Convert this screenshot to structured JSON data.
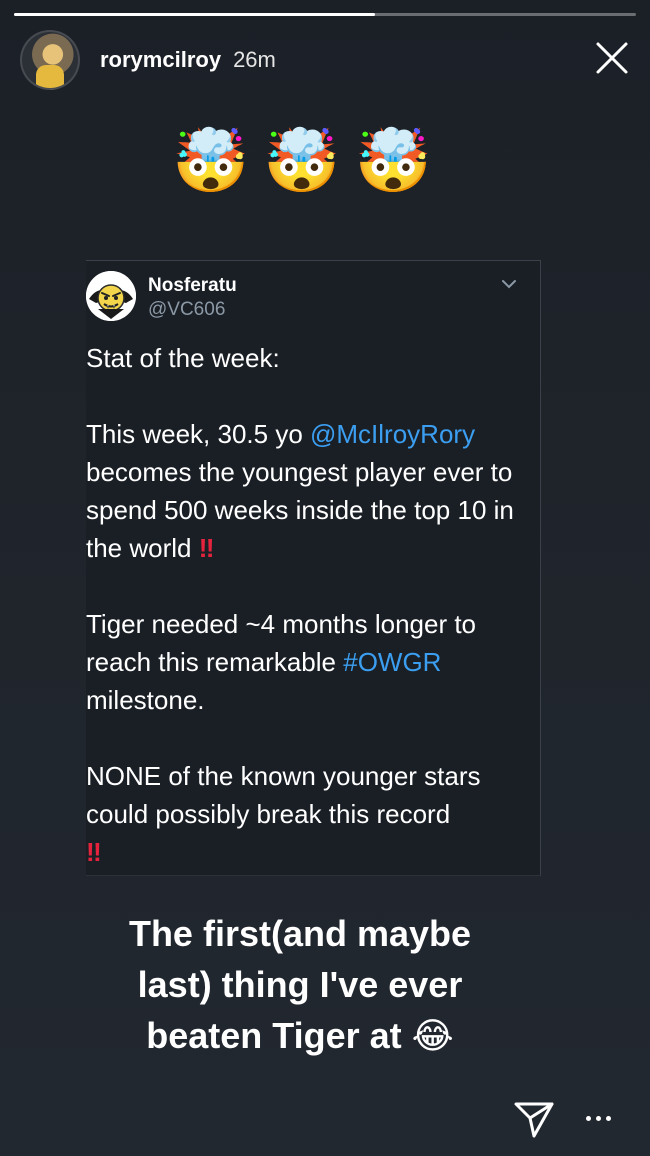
{
  "story": {
    "progress": 0.58,
    "username": "rorymcilroy",
    "time": "26m",
    "emojis": [
      "🤯",
      "🤯",
      "🤯"
    ],
    "caption_line1": "The first(and maybe",
    "caption_line2": "last) thing I've ever",
    "caption_line3": "beaten Tiger at",
    "caption_emoji": "😂"
  },
  "tweet": {
    "name": "Nosferatu",
    "handle": "@VC606",
    "p1": "Stat of the week:",
    "p2_pre": "This week, 30.5 yo ",
    "p2_mention": "@McIlroyRory",
    "p2_post": " becomes the youngest player ever to spend 500 weeks inside the top 10 in the world ",
    "bang": "‼",
    "p3_pre": "Tiger needed ~4 months longer to reach this remarkable ",
    "p3_hashtag": "#OWGR",
    "p3_post": " milestone.",
    "p4": "NONE of the known younger stars could possibly break this record"
  },
  "icons": {
    "close": "close-icon",
    "send": "paper-plane-icon",
    "more": "more-dots-icon",
    "caret": "chevron-down-icon"
  }
}
